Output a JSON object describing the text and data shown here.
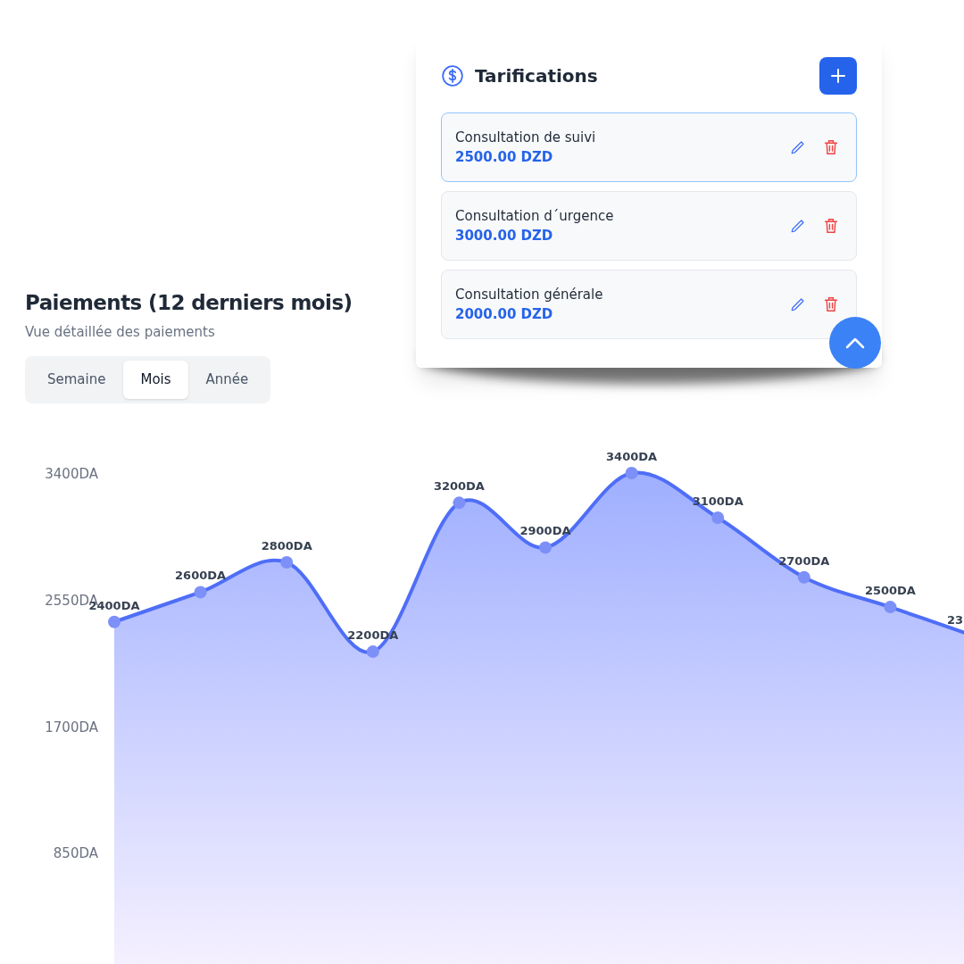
{
  "tarifications": {
    "title": "Tarifications",
    "items": [
      {
        "name": "Consultation de suivi",
        "price": "2500.00 DZD",
        "selected": true
      },
      {
        "name": "Consultation d´urgence",
        "price": "3000.00 DZD",
        "selected": false
      },
      {
        "name": "Consultation générale",
        "price": "2000.00 DZD",
        "selected": false
      }
    ]
  },
  "payments": {
    "title": "Paiements (12 derniers mois)",
    "subtitle": "Vue détaillée des paiements",
    "tabs": [
      {
        "label": "Semaine",
        "selected": false
      },
      {
        "label": "Mois",
        "selected": true
      },
      {
        "label": "Année",
        "selected": false
      }
    ],
    "chart_data": {
      "type": "area",
      "ylim": [
        0,
        3400
      ],
      "yticks": [
        {
          "value": 850,
          "label": "850DA"
        },
        {
          "value": 1700,
          "label": "1700DA"
        },
        {
          "value": 2550,
          "label": "2550DA"
        },
        {
          "value": 3400,
          "label": "3400DA"
        }
      ],
      "series": [
        {
          "color": "#4f6ef7",
          "values": [
            2400,
            2600,
            2800,
            2200,
            3200,
            2900,
            3400,
            3100,
            2700,
            2500,
            2300
          ]
        }
      ],
      "value_labels": [
        "2400DA",
        "2600DA",
        "2800DA",
        "2200DA",
        "3200DA",
        "2900DA",
        "3400DA",
        "3100DA",
        "2700DA",
        "2500DA",
        "23"
      ]
    }
  }
}
